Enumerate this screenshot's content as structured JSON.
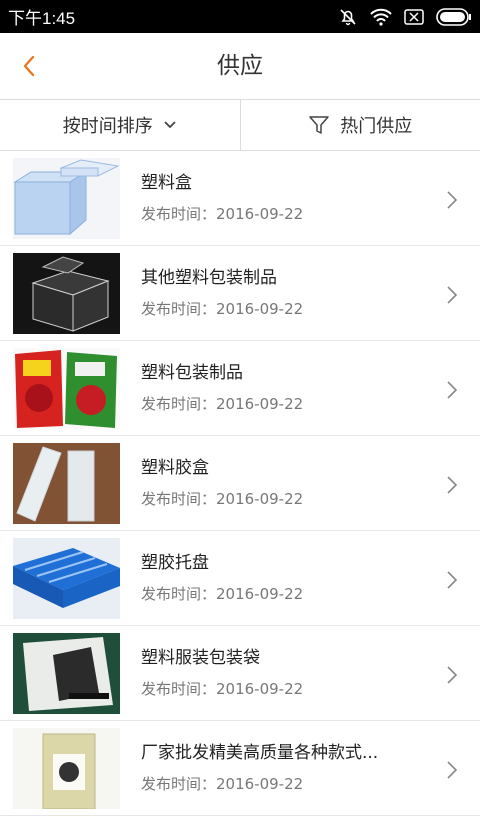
{
  "status_bar": {
    "time": "下午1:45"
  },
  "header": {
    "title": "供应"
  },
  "filters": {
    "sort_label": "按时间排序",
    "hot_label": "热门供应"
  },
  "date_prefix": "发布时间：",
  "items": [
    {
      "title": "塑料盒",
      "date": "发布时间：2016-09-22"
    },
    {
      "title": "其他塑料包装制品",
      "date": "发布时间：2016-09-22"
    },
    {
      "title": "塑料包装制品",
      "date": "发布时间：2016-09-22"
    },
    {
      "title": "塑料胶盒",
      "date": "发布时间：2016-09-22"
    },
    {
      "title": "塑胶托盘",
      "date": "发布时间：2016-09-22"
    },
    {
      "title": "塑料服装包装袋",
      "date": "发布时间：2016-09-22"
    },
    {
      "title": "厂家批发精美高质量各种款式...",
      "date": "发布时间：2016-09-22"
    }
  ],
  "colors": {
    "accent": "#e8741c",
    "divider": "#dcdcdc",
    "status_bg": "#000000"
  },
  "icons": [
    "mute-icon",
    "wifi-icon",
    "sim-icon",
    "battery-icon",
    "back-icon",
    "chevron-down-icon",
    "funnel-icon",
    "chevron-right-icon"
  ]
}
